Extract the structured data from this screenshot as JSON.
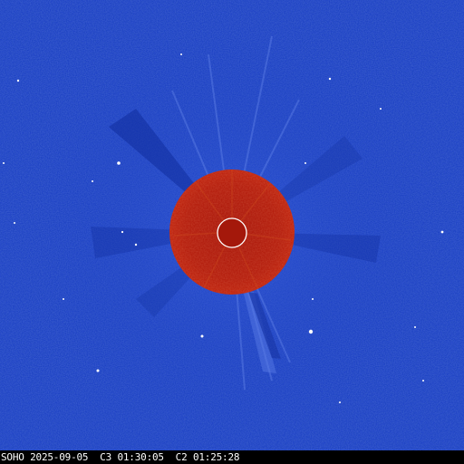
{
  "image": {
    "subject": "LASCO C2/C3 combined coronagraph difference image",
    "colors": {
      "background_blue": "#1a3fc4",
      "occulter_red": "#b01a0a",
      "sun_outline": "#ffffff",
      "caption_bar": "#000000",
      "caption_text": "#ffffff"
    }
  },
  "caption": {
    "text": "SOHO 2025-09-05  C3 01:30:05  C2 01:25:28"
  }
}
